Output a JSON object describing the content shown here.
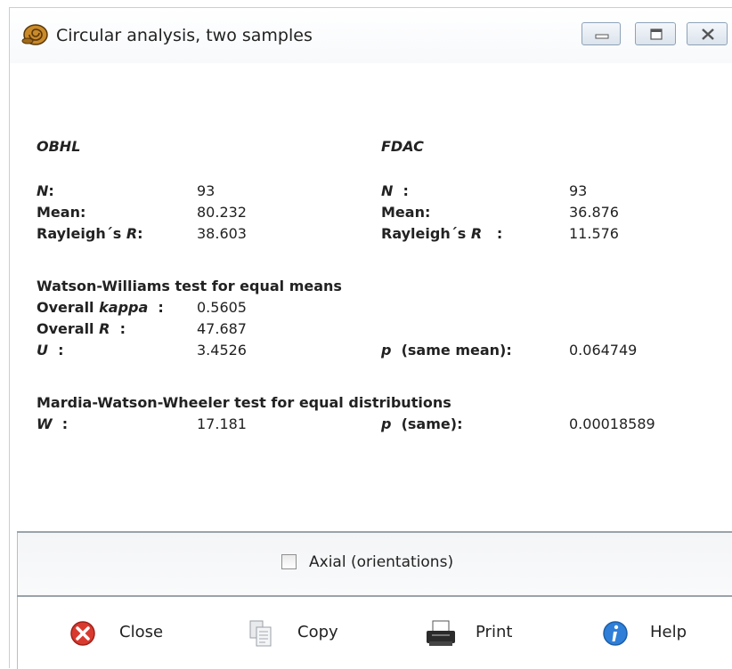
{
  "window": {
    "title": "Circular analysis, two samples"
  },
  "samples": {
    "left": {
      "name": "OBHL",
      "n_label": "N",
      "n_sep": ":",
      "n": "93",
      "mean_label": "Mean:",
      "mean": "80.232",
      "rayleigh_label": "Rayleigh´s",
      "rayleigh_R": "R",
      "rayleigh_sep": ":",
      "rayleigh": "38.603"
    },
    "right": {
      "name": "FDAC",
      "n_label": "N",
      "n_sep": ":",
      "n": "93",
      "mean_label": "Mean:",
      "mean": "36.876",
      "rayleigh_label": "Rayleigh´s",
      "rayleigh_R": "R",
      "rayleigh_sep": ":",
      "rayleigh": "11.576"
    }
  },
  "watson_williams": {
    "heading": "Watson-Williams test for equal means",
    "kappa_label": "Overall",
    "kappa_word": "kappa",
    "kappa_sep": ":",
    "kappa": "0.5605",
    "R_label": "Overall",
    "R_word": "R",
    "R_sep": ":",
    "R": "47.687",
    "U_label": "U",
    "U_sep": ":",
    "U": "3.4526",
    "p_label": "p",
    "p_text": "(same mean):",
    "p": "0.064749"
  },
  "mardia": {
    "heading": "Mardia-Watson-Wheeler test for equal distributions",
    "W_label": "W",
    "W_sep": ":",
    "W": "17.181",
    "p_label": "p",
    "p_text": "(same):",
    "p": "0.00018589"
  },
  "axial": {
    "label": "Axial (orientations)",
    "checked": false
  },
  "buttons": {
    "close": "Close",
    "copy": "Copy",
    "print": "Print",
    "help": "Help"
  },
  "icons": [
    "app-icon",
    "minimize-icon",
    "maximize-icon",
    "close-window-icon",
    "close-icon",
    "copy-icon",
    "print-icon",
    "help-icon"
  ]
}
